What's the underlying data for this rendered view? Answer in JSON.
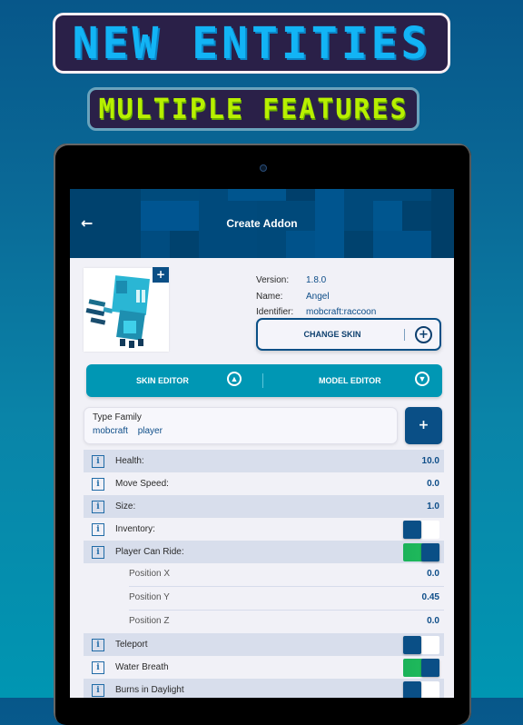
{
  "promo": {
    "headline": "NEW ENTITIES",
    "subheadline": "MULTIPLE FEATURES"
  },
  "appbar": {
    "back_icon": "arrow-left-icon",
    "title": "Create Addon"
  },
  "entity": {
    "avatar_alt": "entity skin preview",
    "avatar_add_label": "+",
    "fields": [
      {
        "label": "Version:",
        "value": "1.8.0"
      },
      {
        "label": "Name:",
        "value": "Angel"
      },
      {
        "label": "Identifier:",
        "value": "mobcraft:raccoon"
      }
    ],
    "change_skin_label": "CHANGE SKIN",
    "change_skin_icon": "plus-circle-icon"
  },
  "editors": {
    "skin_editor_label": "SKIN EDITOR",
    "skin_editor_icon": "skin-editor-icon",
    "model_editor_label": "MODEL EDITOR",
    "model_editor_icon": "wrench-icon"
  },
  "type_family": {
    "label": "Type Family",
    "tags": [
      "mobcraft",
      "player"
    ],
    "add_label": "+"
  },
  "properties": [
    {
      "label": "Health:",
      "value": "10.0",
      "kind": "number"
    },
    {
      "label": "Move Speed:",
      "value": "0.0",
      "kind": "number"
    },
    {
      "label": "Size:",
      "value": "1.0",
      "kind": "number"
    },
    {
      "label": "Inventory:",
      "kind": "toggle",
      "on": false
    },
    {
      "label": "Player Can Ride:",
      "kind": "toggle",
      "on": true
    },
    {
      "label": "Teleport",
      "kind": "toggle",
      "on": false
    },
    {
      "label": "Water Breath",
      "kind": "toggle",
      "on": true
    },
    {
      "label": "Burns in Daylight",
      "kind": "toggle",
      "on": false
    }
  ],
  "ride_position": [
    {
      "label": "Position X",
      "value": "0.0"
    },
    {
      "label": "Position Y",
      "value": "0.45"
    },
    {
      "label": "Position Z",
      "value": "0.0"
    }
  ],
  "info_icon_glyph": "i",
  "colors": {
    "primary": "#0a4f86",
    "accent_teal": "#0097b4",
    "toggle_on": "#1db954",
    "headline": "#12b4f5",
    "subheadline": "#b8f000"
  }
}
